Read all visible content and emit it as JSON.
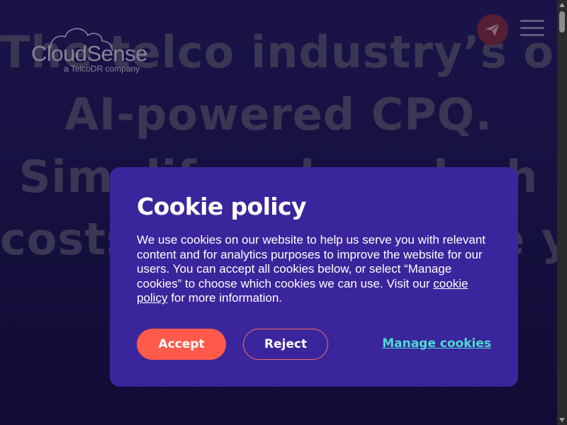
{
  "hero": {
    "lines": [
      "The telco industry’s only",
      "AI-powered CPQ.",
      "Simplify sales, slash",
      "costs and accelerate your"
    ]
  },
  "logo": {
    "name": "CloudSense",
    "tagline": "a TelcoDR company"
  },
  "header": {
    "send_icon": "paper-plane-icon",
    "menu_icon": "hamburger-menu-icon"
  },
  "cookie_dialog": {
    "title": "Cookie policy",
    "body_text": "We use cookies on our website to help us serve you with relevant content and for analytics purposes to improve the website for our users. You can accept all cookies below, or select “Manage cookies” to choose which cookies we can use. Visit our ",
    "policy_link": "cookie policy",
    "body_text_end": " for more information.",
    "accept_label": "Accept",
    "reject_label": "Reject",
    "manage_label": "Manage cookies"
  },
  "colors": {
    "dialog_bg": "#3b259c",
    "accept_bg": "#ff5a4a",
    "manage_link": "#4ddbd1",
    "page_bg": "#1d164f"
  }
}
